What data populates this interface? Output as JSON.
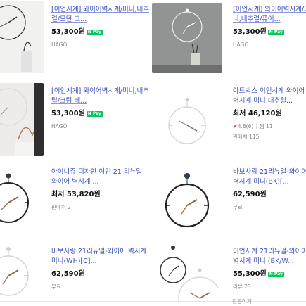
{
  "products": [
    {
      "title": "[이언시계] 와이어벽시계/미니,내추럴/모던 그...",
      "price": "53,300원",
      "npay": "N Pay",
      "meta": "HAGO",
      "meta2": ""
    },
    {
      "title": "[이언시계] 와이어벽시계/미니,내추럴/퓨어...",
      "price": "53,300원",
      "npay": "N Pay",
      "meta": "HAGO",
      "meta2": ""
    },
    {
      "title": "[이언시계] 와이어벽시계/미니,내추럴/크림 베...",
      "price": "53,300원",
      "npay": "N Pay",
      "meta": "HAGO",
      "meta2": ""
    },
    {
      "title": "아트박스 이언시계 와이어벽시계 미니,내추럴...",
      "price": "최저 46,120원",
      "npay": "",
      "rating": "4.8(6)",
      "reviews": "찜 11",
      "meta": "",
      "meta2": "판매처 115"
    },
    {
      "title": "아이니쥬 디자인 이언 21 리뉴얼 와이어 벽시계 ...",
      "price": "최저 53,820원",
      "npay": "",
      "meta": "판매처 2",
      "meta2": ""
    },
    {
      "title": "바보사랑 21리뉴얼-와이어 벽시계 미니(BK)[...",
      "price": "62,590원",
      "npay": "",
      "meta": "무료",
      "meta2": ""
    },
    {
      "title": "바보사랑 21리뉴얼-와이어 벽시계 미니(WH)[C]...",
      "price": "62,590원",
      "npay": "",
      "meta": "무료",
      "meta2": ""
    },
    {
      "title": "이언시계 21리뉴얼-와이어벽시계 미니 (BK/W...",
      "price": "55,300원",
      "npay": "N Pay",
      "meta": "리뷰 23",
      "meta2": ""
    }
  ],
  "footer": {
    "more_label": "진공미기"
  },
  "colors": {
    "link": "#3a4dbf",
    "npay": "#03c75a",
    "star": "#f04b4b"
  }
}
